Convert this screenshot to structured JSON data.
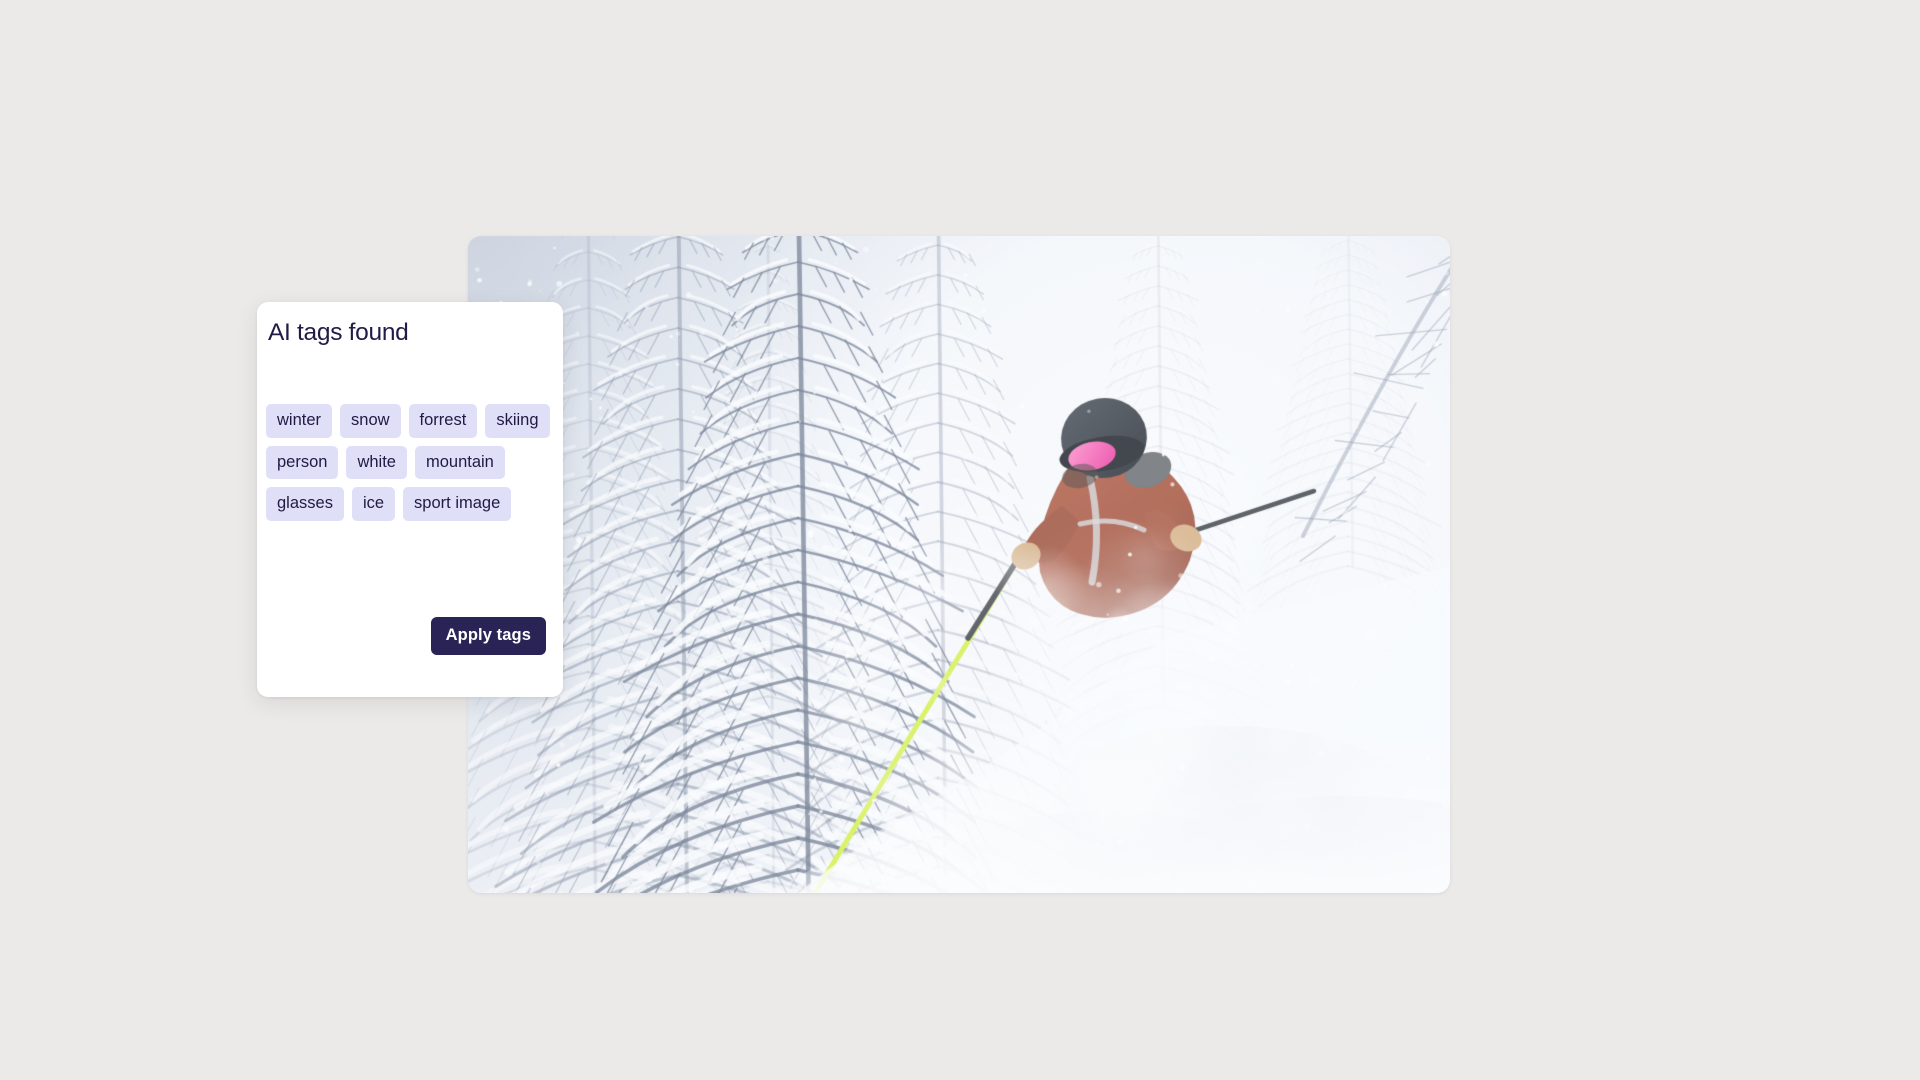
{
  "page": {
    "background_color": "#ECEAE8"
  },
  "card": {
    "title": "AI tags found",
    "background_color": "#FFFFFF",
    "title_color": "#221B47",
    "tags": [
      "winter",
      "snow",
      "forrest",
      "skiing",
      "person",
      "white",
      "mountain",
      "glasses",
      "ice",
      "sport image"
    ],
    "tag_pill_color": "#DFDFF8",
    "tag_text_color": "#201A44",
    "apply_button": {
      "label": "Apply tags",
      "background_color": "#2A2356",
      "text_color": "#FFFFFF"
    }
  },
  "photo": {
    "alt": "skier in rust-colored jacket with dark helmet and pink goggles carving through deep powder snow in a snow-covered conifer forest",
    "accent_colors": {
      "snow_light": "#FAFBFD",
      "snow_shadow": "#C4CBDA",
      "tree_dark": "#8C96AA",
      "jacket": "#A8563F",
      "helmet": "#3A3F48",
      "goggles": "#F24FAE",
      "pole": "#D6F24A",
      "glove": "#D8B286"
    }
  }
}
